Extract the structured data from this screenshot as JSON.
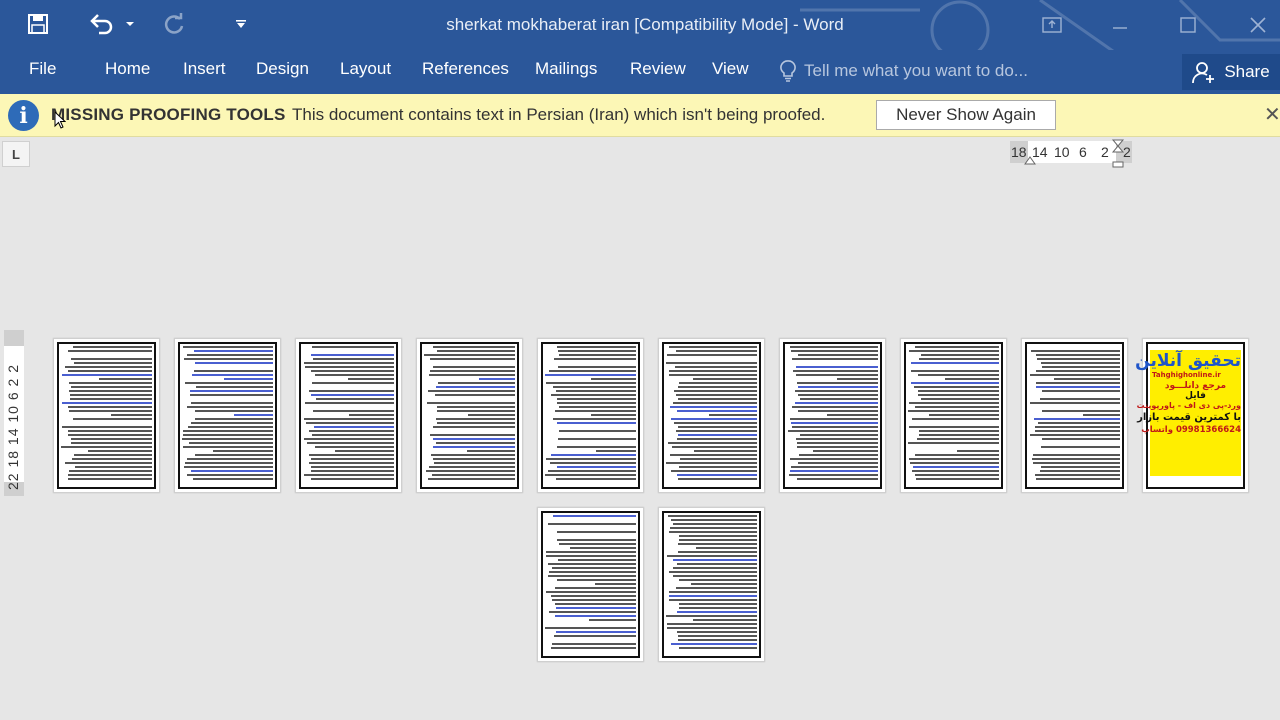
{
  "window": {
    "title": "sherkat mokhaberat iran [Compatibility Mode] - Word"
  },
  "qat": {
    "save_icon": "save-icon",
    "undo_icon": "undo-icon",
    "redo_icon": "redo-icon",
    "customize_icon": "customize-qat-icon"
  },
  "ribbon": {
    "tabs": [
      "File",
      "Home",
      "Insert",
      "Design",
      "Layout",
      "References",
      "Mailings",
      "Review",
      "View"
    ],
    "tell_me_placeholder": "Tell me what you want to do...",
    "share_label": "Share"
  },
  "message_bar": {
    "title": "MISSING PROOFING TOOLS",
    "text": "This document contains text in Persian (Iran) which isn't being proofed.",
    "button_label": "Never Show Again",
    "close_glyph": "✕"
  },
  "ruler": {
    "corner_glyph": "L",
    "horizontal_ticks": [
      "18",
      "14",
      "10",
      "6",
      "2",
      "2"
    ],
    "vertical_text": "22 18 14 10 6 2 2"
  },
  "ad_page": {
    "line1": "تحقیق آنلاین",
    "line2": "Tahghighonline.ir",
    "line3": "مرجع دانلـــود",
    "line4": "فایل",
    "line5": "ورد-پی دی اف - پاورپوینت",
    "line6": "با کمترین قیمت بازار",
    "line7": "09981366624 واتساپ"
  },
  "colors": {
    "title_bar": "#2b579a",
    "message_bar": "#fcf7b6",
    "workspace": "#e6e6e6",
    "ad_background": "#ffee00"
  }
}
